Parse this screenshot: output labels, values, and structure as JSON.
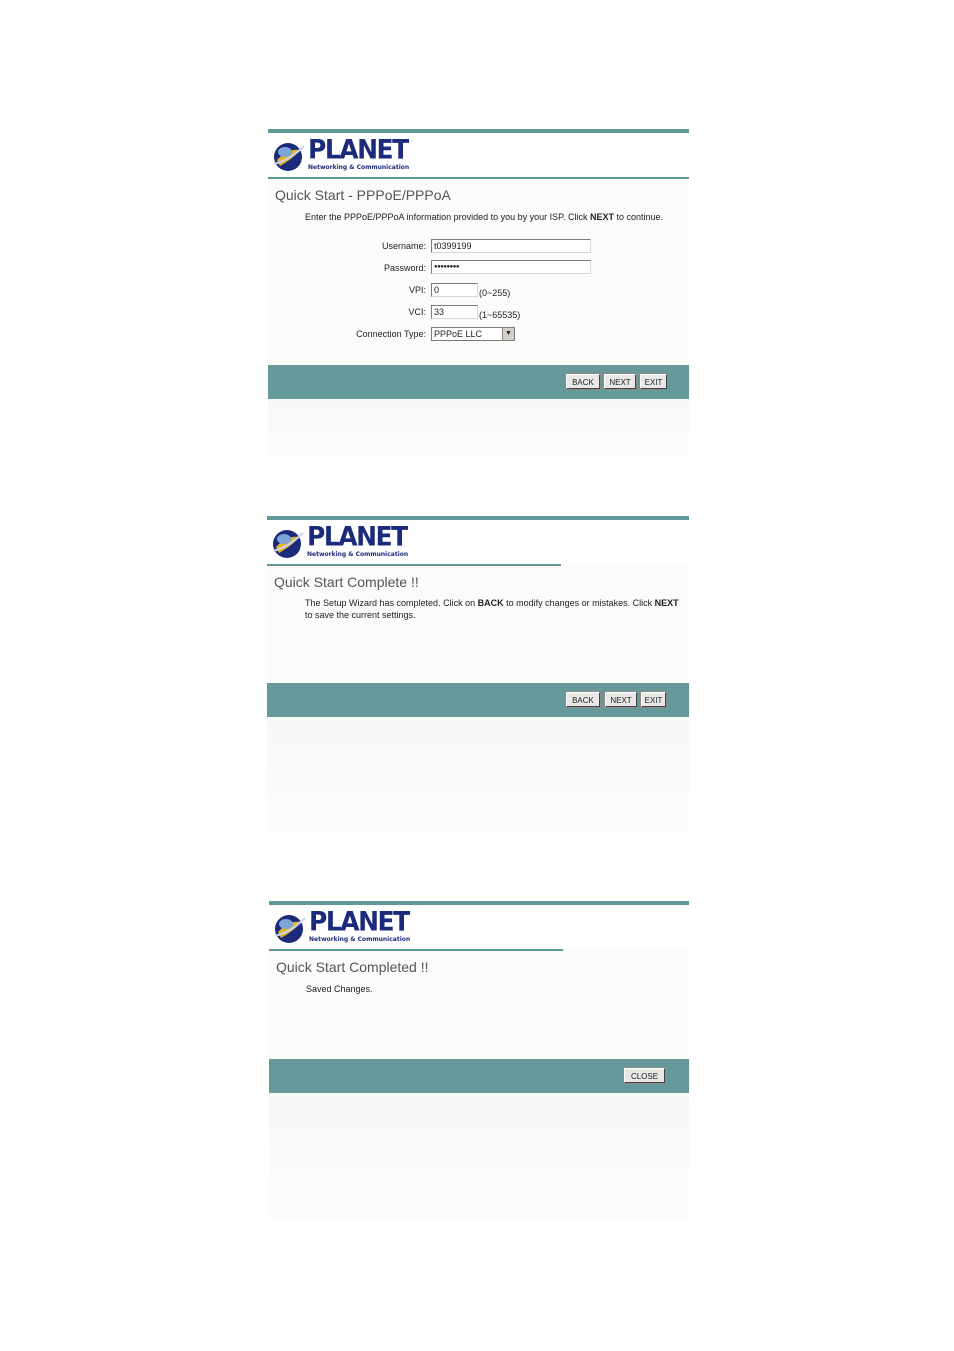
{
  "brand": {
    "name": "PLANET",
    "tagline": "Networking & Communication",
    "colors": {
      "primary": "#1c2a7c",
      "bar": "#669999",
      "accent": "#5f9896"
    }
  },
  "panel1": {
    "title": "Quick Start - PPPoE/PPPoA",
    "description_prefix": "Enter the PPPoE/PPPoA information provided to you by your ISP. Click ",
    "description_bold": "NEXT",
    "description_suffix": " to continue.",
    "username_label": "Username:",
    "username_value": "t0399199",
    "password_label": "Password:",
    "password_value": "●●●●●●●●",
    "vpi_label": "VPI:",
    "vpi_value": "0",
    "vpi_range": "(0~255)",
    "vci_label": "VCI:",
    "vci_value": "33",
    "vci_range": "(1~65535)",
    "connection_type_label": "Connection Type:",
    "connection_type_value": "PPPoE LLC",
    "buttons": {
      "back": "BACK",
      "next": "NEXT",
      "exit": "EXIT"
    }
  },
  "panel2": {
    "title": "Quick Start Complete !!",
    "text_1": "The Setup Wizard has completed. Click on ",
    "bold_1": "BACK",
    "text_2": " to modify changes or mistakes. Click ",
    "bold_2": "NEXT",
    "text_3": "to save the current settings.",
    "buttons": {
      "back": "BACK",
      "next": "NEXT",
      "exit": "EXIT"
    }
  },
  "panel3": {
    "title": "Quick Start Completed !!",
    "message": "Saved Changes.",
    "buttons": {
      "close": "CLOSE"
    }
  }
}
